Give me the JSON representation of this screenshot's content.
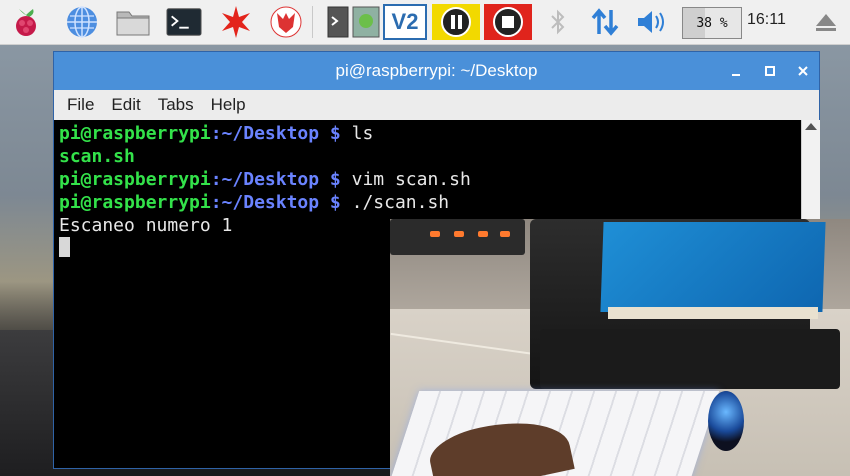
{
  "taskbar": {
    "launchers": [
      {
        "name": "raspberry-menu-icon"
      },
      {
        "name": "web-browser-icon"
      },
      {
        "name": "file-manager-icon"
      },
      {
        "name": "terminal-icon"
      },
      {
        "name": "mathematica-icon"
      },
      {
        "name": "wolfram-icon"
      }
    ],
    "vnc_label": "V2",
    "cpu_usage": "38 %",
    "clock": "16:11"
  },
  "window": {
    "title": "pi@raspberrypi: ~/Desktop",
    "menu": [
      "File",
      "Edit",
      "Tabs",
      "Help"
    ]
  },
  "terminal": {
    "prompt_user": "pi@raspberrypi",
    "prompt_path": ":~/Desktop $",
    "lines": [
      {
        "type": "command",
        "command": " ls"
      },
      {
        "type": "output_green",
        "text": "scan.sh"
      },
      {
        "type": "command",
        "command": " vim scan.sh"
      },
      {
        "type": "command",
        "command": " ./scan.sh"
      },
      {
        "type": "output",
        "text": "Escaneo numero 1"
      }
    ]
  },
  "colors": {
    "prompt_user": "#33e24a",
    "prompt_path": "#6a83ff",
    "titlebar": "#4a90d9",
    "pause_button": "#f2d900",
    "stop_button": "#e0241c"
  }
}
